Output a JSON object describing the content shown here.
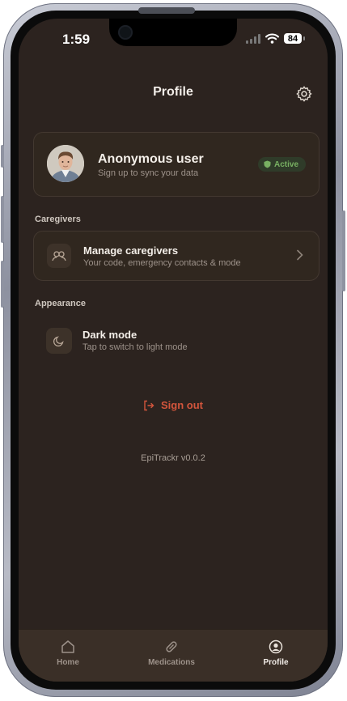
{
  "status": {
    "time": "1:59",
    "battery": "84"
  },
  "header": {
    "title": "Profile"
  },
  "user": {
    "name": "Anonymous user",
    "subtitle": "Sign up to sync your data",
    "badge": "Active"
  },
  "sections": {
    "caregivers": {
      "label": "Caregivers",
      "title": "Manage caregivers",
      "subtitle": "Your code, emergency contacts & mode"
    },
    "appearance": {
      "label": "Appearance",
      "title": "Dark mode",
      "subtitle": "Tap to switch to light mode"
    }
  },
  "actions": {
    "sign_out": "Sign out"
  },
  "app_version": "EpiTrackr v0.0.2",
  "tabs": [
    {
      "label": "Home",
      "icon": "home-icon"
    },
    {
      "label": "Medications",
      "icon": "pill-icon"
    },
    {
      "label": "Profile",
      "icon": "profile-icon",
      "active": true
    }
  ],
  "colors": {
    "background": "#2c231f",
    "accent_danger": "#d3553c",
    "badge_green": "#78b062"
  }
}
